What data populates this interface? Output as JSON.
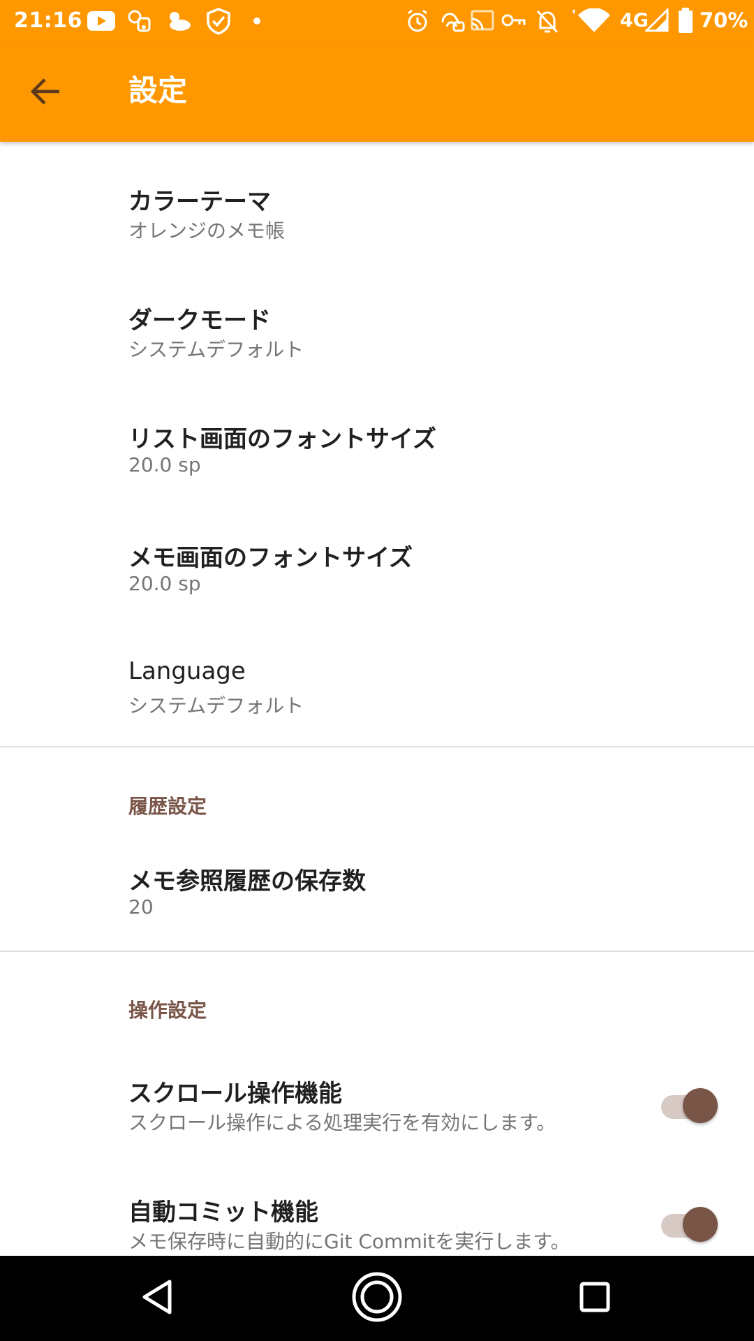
{
  "status_bar": {
    "time": "21:16",
    "network": "4G",
    "battery": "70%",
    "icons_left": [
      "youtube-icon",
      "weather-icon",
      "weather-cloud-icon",
      "shield-check-icon",
      "dot-icon"
    ],
    "icons_right": [
      "alarm-icon",
      "nfc-icon",
      "cast-icon",
      "vpn-key-icon",
      "bell-off-icon",
      "wifi-icon",
      "signal-icon",
      "battery-icon"
    ]
  },
  "app_bar": {
    "title": "設定",
    "back_icon": "arrow-back-icon"
  },
  "general_items": [
    {
      "title": "カラーテーマ",
      "summary": "オレンジのメモ帳"
    },
    {
      "title": "ダークモード",
      "summary": "システムデフォルト"
    },
    {
      "title": "リスト画面のフォントサイズ",
      "summary": "20.0 sp"
    },
    {
      "title": "メモ画面のフォントサイズ",
      "summary": "20.0 sp"
    },
    {
      "title": "Language",
      "summary": "システムデフォルト"
    }
  ],
  "history_section": {
    "header": "履歴設定",
    "items": [
      {
        "title": "メモ参照履歴の保存数",
        "summary": "20"
      }
    ]
  },
  "operation_section": {
    "header": "操作設定",
    "items": [
      {
        "title": "スクロール操作機能",
        "summary": "スクロール操作による処理実行を有効にします。",
        "enabled": true
      },
      {
        "title": "自動コミット機能",
        "summary": "メモ保存時に自動的にGit Commitを実行します。",
        "enabled": true
      }
    ]
  },
  "nav_bar": {
    "buttons": [
      "back-triangle-icon",
      "home-circle-icon",
      "recents-square-icon"
    ]
  },
  "colors": {
    "primary": "#ff9800",
    "accent": "#795548",
    "toggle_track": "#d7c9c3",
    "category_text": "#795548"
  }
}
